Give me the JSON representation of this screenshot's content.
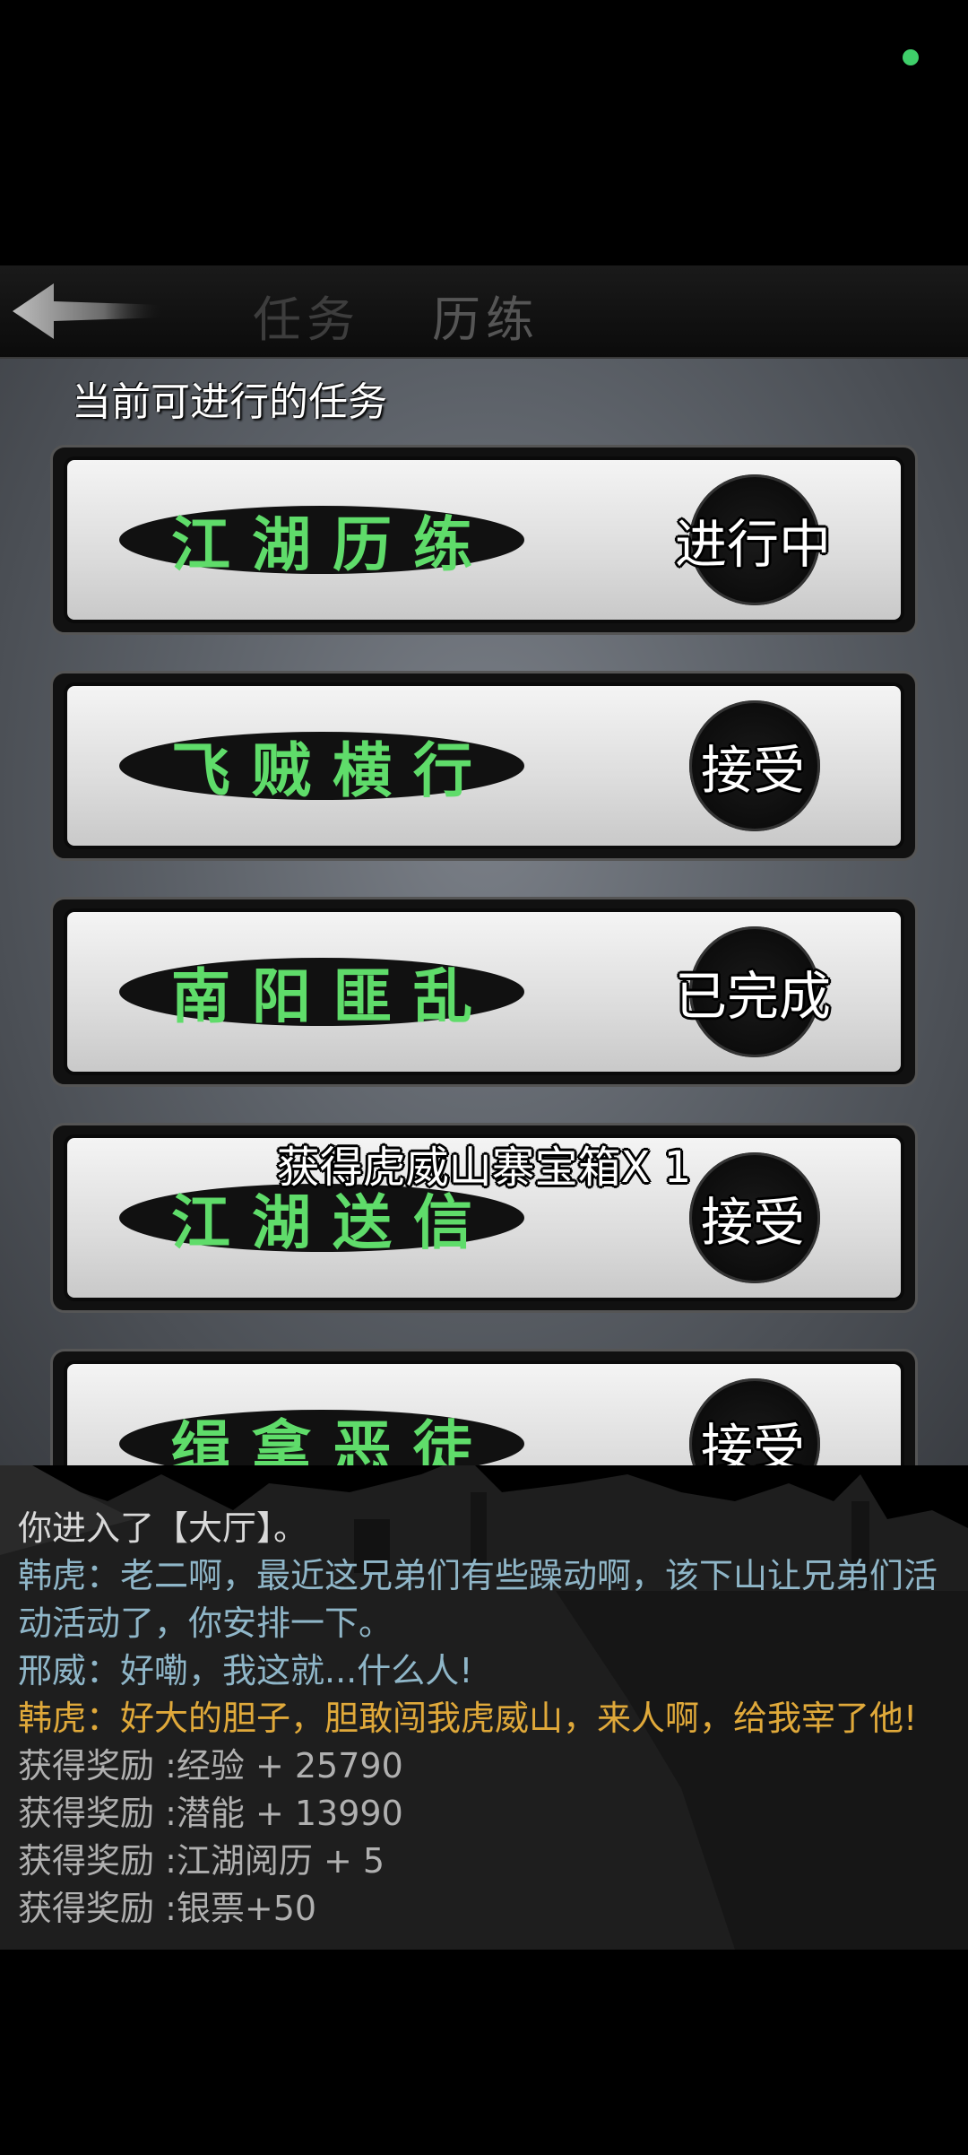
{
  "header": {
    "tabs": [
      {
        "label": "任务"
      },
      {
        "label": "历练"
      }
    ]
  },
  "subtitle": "当前可进行的任务",
  "tasks": [
    {
      "name": "江湖历练",
      "button": "进行中"
    },
    {
      "name": "飞贼横行",
      "button": "接受"
    },
    {
      "name": "南阳匪乱",
      "button": "已完成"
    },
    {
      "name": "江湖送信",
      "button": "接受"
    },
    {
      "name": "缉拿恶徒",
      "button": "接受"
    }
  ],
  "toast": "获得虎威山寨宝箱X 1",
  "log": [
    {
      "text": "你进入了【大厅】。",
      "color": "#d9d9d9"
    },
    {
      "text": "韩虎：老二啊，最近这兄弟们有些躁动啊，该下山让兄弟们活动活动了，你安排一下。",
      "color": "#8fb6c8"
    },
    {
      "text": "邢威：好嘞，我这就...什么人!",
      "color": "#8fb6c8"
    },
    {
      "text": "韩虎：好大的胆子，胆敢闯我虎威山，来人啊，给我宰了他!",
      "color": "#e0a93a"
    },
    {
      "text": "获得奖励 :经验 + 25790",
      "color": "#b0b0b0"
    },
    {
      "text": "获得奖励 :潜能 + 13990",
      "color": "#b0b0b0"
    },
    {
      "text": "获得奖励 :江湖阅历 + 5",
      "color": "#b0b0b0"
    },
    {
      "text": "获得奖励 :银票+50",
      "color": "#b0b0b0"
    }
  ]
}
